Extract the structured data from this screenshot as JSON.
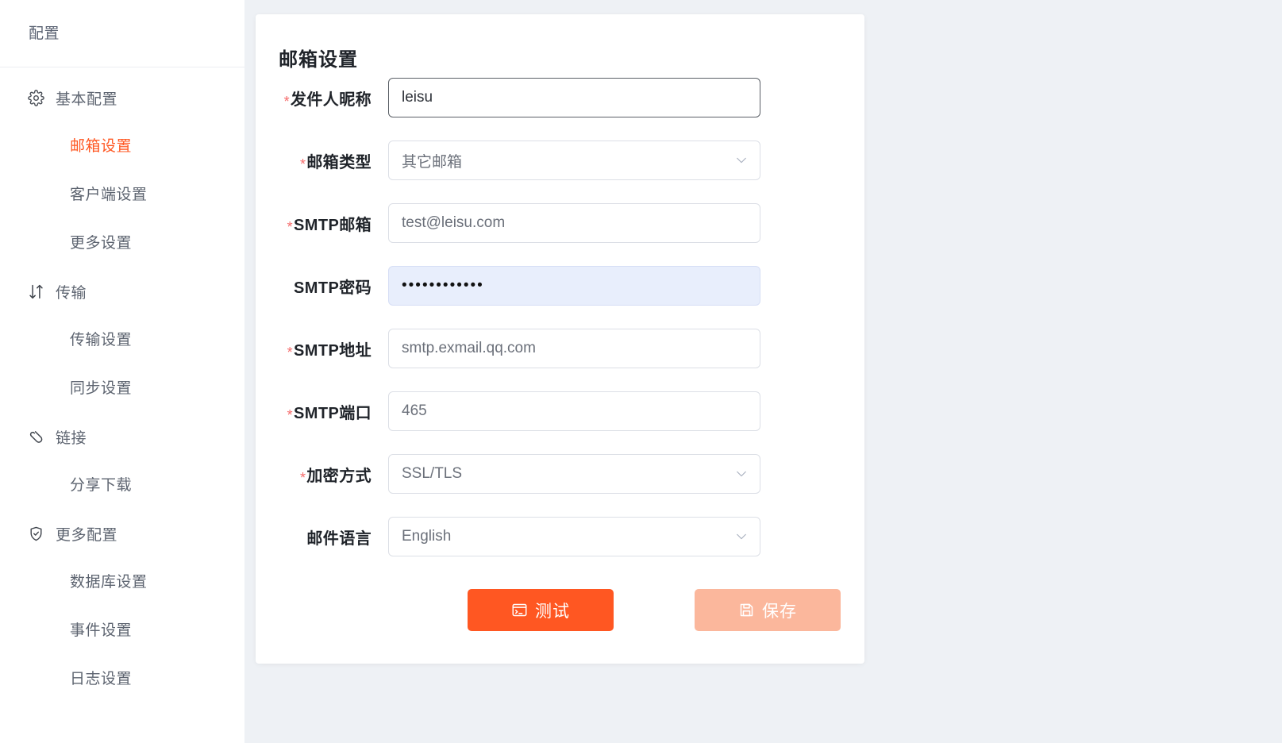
{
  "sidebar": {
    "title": "配置",
    "groups": [
      {
        "label": "基本配置",
        "icon": "gear-icon",
        "items": [
          {
            "label": "邮箱设置",
            "active": true
          },
          {
            "label": "客户端设置",
            "active": false
          },
          {
            "label": "更多设置",
            "active": false
          }
        ]
      },
      {
        "label": "传输",
        "icon": "transfer-arrows-icon",
        "items": [
          {
            "label": "传输设置",
            "active": false
          },
          {
            "label": "同步设置",
            "active": false
          }
        ]
      },
      {
        "label": "链接",
        "icon": "link-icon",
        "items": [
          {
            "label": "分享下载",
            "active": false
          }
        ]
      },
      {
        "label": "更多配置",
        "icon": "shield-check-icon",
        "items": [
          {
            "label": "数据库设置",
            "active": false
          },
          {
            "label": "事件设置",
            "active": false
          },
          {
            "label": "日志设置",
            "active": false
          }
        ]
      }
    ]
  },
  "card": {
    "title": "邮箱设置",
    "fields": [
      {
        "label": "发件人昵称",
        "required": true,
        "type": "text",
        "value": "leisu",
        "placeholder": "",
        "state": "focused"
      },
      {
        "label": "邮箱类型",
        "required": true,
        "type": "select",
        "value": "其它邮箱",
        "placeholder": "",
        "state": "normal"
      },
      {
        "label": "SMTP邮箱",
        "required": true,
        "type": "text",
        "value": "test@leisu.com",
        "placeholder": "",
        "state": "normal"
      },
      {
        "label": "SMTP密码",
        "required": false,
        "type": "password",
        "value": "••••••••••••",
        "placeholder": "",
        "state": "autofilled"
      },
      {
        "label": "SMTP地址",
        "required": true,
        "type": "text",
        "value": "smtp.exmail.qq.com",
        "placeholder": "",
        "state": "normal"
      },
      {
        "label": "SMTP端口",
        "required": true,
        "type": "text",
        "value": "465",
        "placeholder": "",
        "state": "normal"
      },
      {
        "label": "加密方式",
        "required": true,
        "type": "select",
        "value": "SSL/TLS",
        "placeholder": "",
        "state": "normal"
      },
      {
        "label": "邮件语言",
        "required": false,
        "type": "select",
        "value": "English",
        "placeholder": "",
        "state": "normal"
      }
    ],
    "buttons": {
      "test": {
        "label": "测试",
        "icon": "console-icon"
      },
      "save": {
        "label": "保存",
        "icon": "save-icon",
        "disabled": true
      }
    }
  },
  "colors": {
    "accent": "#ff5722",
    "accent_disabled": "#fbb79c",
    "required_star": "#f56c6c",
    "page_background": "#eef1f5",
    "autofill_background": "#e8eefc"
  }
}
